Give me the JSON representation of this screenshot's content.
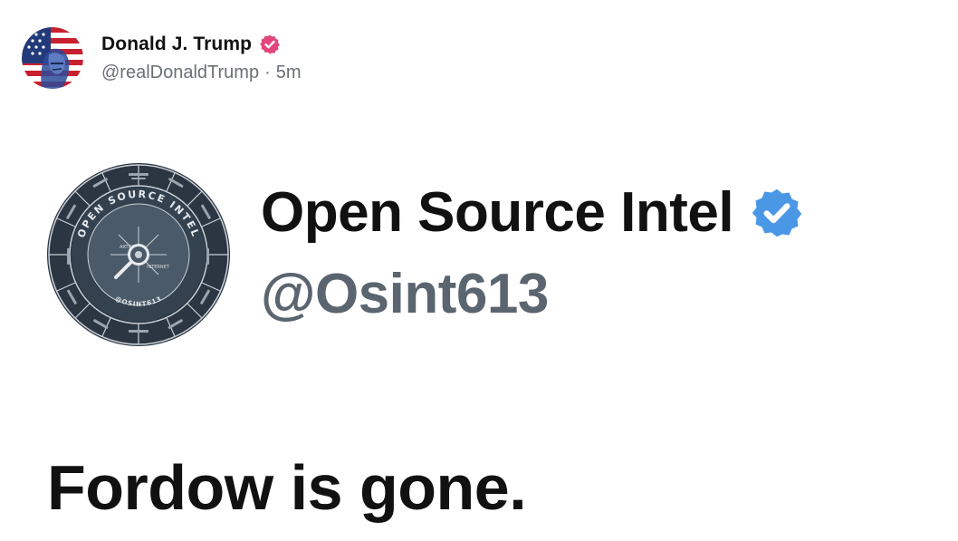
{
  "post": {
    "author_name": "Donald J. Trump",
    "author_handle": "@realDonaldTrump",
    "separator": "·",
    "time_ago": "5m",
    "verified_badge_icon": "verified-badge-icon",
    "verified_badge_color": "#e2467a"
  },
  "embedded_profile": {
    "logo_text_top": "OPEN SOURCE INTEL",
    "logo_text_bottom": "@OSINT613",
    "logo_center_labels": [
      "ARTICLES",
      "INTERNET"
    ],
    "display_name": "Open Source Intel",
    "handle": "@Osint613",
    "verified_badge_icon": "verified-check-icon",
    "verified_badge_color": "#4a97e6"
  },
  "text": "Fordow is gone."
}
